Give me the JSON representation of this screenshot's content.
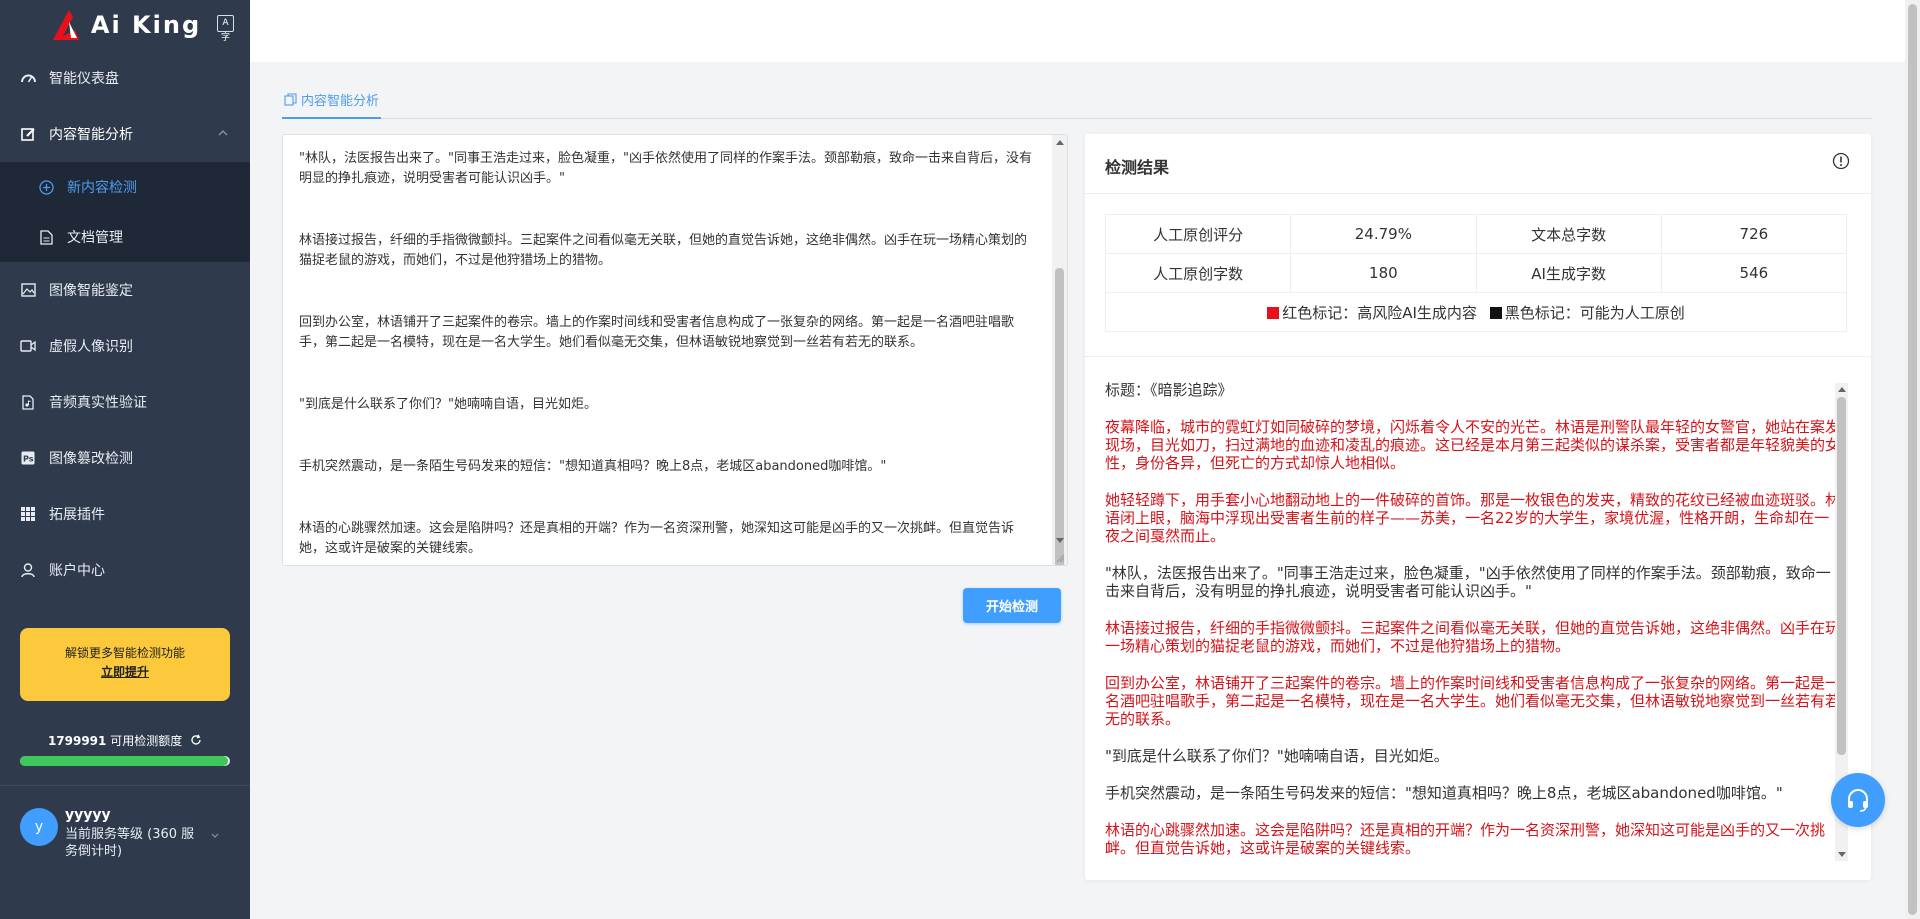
{
  "brand": {
    "name": "Ai King",
    "translate_icon": "A字"
  },
  "sidebar": {
    "items": [
      {
        "label": "智能仪表盘",
        "icon": "dashboard-icon"
      },
      {
        "label": "内容智能分析",
        "icon": "edit-icon",
        "open": true,
        "children": [
          {
            "label": "新内容检测",
            "icon": "add-circle-icon",
            "active": true
          },
          {
            "label": "文档管理",
            "icon": "document-icon"
          }
        ]
      },
      {
        "label": "图像智能鉴定",
        "icon": "image-icon"
      },
      {
        "label": "虚假人像识别",
        "icon": "video-icon"
      },
      {
        "label": "音频真实性验证",
        "icon": "audio-file-icon"
      },
      {
        "label": "图像篡改检测",
        "icon": "ps-icon"
      },
      {
        "label": "拓展插件",
        "icon": "grid-icon"
      },
      {
        "label": "账户中心",
        "icon": "user-icon"
      }
    ],
    "upgrade": {
      "line1": "解锁更多智能检测功能",
      "link": "立即提升"
    },
    "quota": {
      "count": "1799991",
      "label": "可用检测额度",
      "fill_fraction": 0.99
    },
    "user": {
      "avatar_letter": "y",
      "name": "yyyyy",
      "level": "当前服务等级 (360 服务倒计时)"
    }
  },
  "tabs": [
    {
      "label": "内容智能分析",
      "active": true
    }
  ],
  "input": {
    "paragraphs": [
      "\"林队，法医报告出来了。\"同事王浩走过来，脸色凝重，\"凶手依然使用了同样的作案手法。颈部勒痕，致命一击来自背后，没有明显的挣扎痕迹，说明受害者可能认识凶手。\"",
      "林语接过报告，纤细的手指微微颤抖。三起案件之间看似毫无关联，但她的直觉告诉她，这绝非偶然。凶手在玩一场精心策划的猫捉老鼠的游戏，而她们，不过是他狩猎场上的猎物。",
      "回到办公室，林语铺开了三起案件的卷宗。墙上的作案时间线和受害者信息构成了一张复杂的网络。第一起是一名酒吧驻唱歌手，第二起是一名模特，现在是一名大学生。她们看似毫无交集，但林语敏锐地察觉到一丝若有若无的联系。",
      "\"到底是什么联系了你们？\"她喃喃自语，目光如炬。",
      "手机突然震动，是一条陌生号码发来的短信：\"想知道真相吗？晚上8点，老城区abandoned咖啡馆。\"",
      "林语的心跳骤然加速。这会是陷阱吗？还是真相的开端？作为一名资深刑警，她深知这可能是凶手的又一次挑衅。但直觉告诉她，这或许是破案的关键线索。"
    ]
  },
  "start_button": "开始检测",
  "result": {
    "title": "检测结果",
    "stats": {
      "human_score_label": "人工原创评分",
      "human_score": "24.79%",
      "total_label": "文本总字数",
      "total": "726",
      "human_count_label": "人工原创字数",
      "human_count": "180",
      "ai_count_label": "AI生成字数",
      "ai_count": "546"
    },
    "legend": {
      "red_label": "红色标记：高风险AI生成内容",
      "red_color": "#e8101a",
      "black_label": "黑色标记：可能为人工原创",
      "black_color": "#111111"
    },
    "doc_title": "标题：《暗影追踪》",
    "segments": [
      {
        "type": "ai",
        "text": "夜幕降临，城市的霓虹灯如同破碎的梦境，闪烁着令人不安的光芒。林语是刑警队最年轻的女警官，她站在案发现场，目光如刀，扫过满地的血迹和凌乱的痕迹。这已经是本月第三起类似的谋杀案，受害者都是年轻貌美的女性，身份各异，但死亡的方式却惊人地相似。"
      },
      {
        "type": "ai",
        "text": "她轻轻蹲下，用手套小心地翻动地上的一件破碎的首饰。那是一枚银色的发夹，精致的花纹已经被血迹斑驳。林语闭上眼，脑海中浮现出受害者生前的样子——苏美，一名22岁的大学生，家境优渥，性格开朗，生命却在一夜之间戛然而止。"
      },
      {
        "type": "human",
        "text": "\"林队，法医报告出来了。\"同事王浩走过来，脸色凝重，\"凶手依然使用了同样的作案手法。颈部勒痕，致命一击来自背后，没有明显的挣扎痕迹，说明受害者可能认识凶手。\""
      },
      {
        "type": "ai",
        "text": "林语接过报告，纤细的手指微微颤抖。三起案件之间看似毫无关联，但她的直觉告诉她，这绝非偶然。凶手在玩一场精心策划的猫捉老鼠的游戏，而她们，不过是他狩猎场上的猎物。"
      },
      {
        "type": "ai",
        "text": "回到办公室，林语铺开了三起案件的卷宗。墙上的作案时间线和受害者信息构成了一张复杂的网络。第一起是一名酒吧驻唱歌手，第二起是一名模特，现在是一名大学生。她们看似毫无交集，但林语敏锐地察觉到一丝若有若无的联系。"
      },
      {
        "type": "human",
        "text": "\"到底是什么联系了你们？\"她喃喃自语，目光如炬。"
      },
      {
        "type": "human",
        "text": "手机突然震动，是一条陌生号码发来的短信：\"想知道真相吗？晚上8点，老城区abandoned咖啡馆。\""
      },
      {
        "type": "ai",
        "text": "林语的心跳骤然加速。这会是陷阱吗？还是真相的开端？作为一名资深刑警，她深知这可能是凶手的又一次挑衅。但直觉告诉她，这或许是破案的关键线索。"
      }
    ]
  }
}
